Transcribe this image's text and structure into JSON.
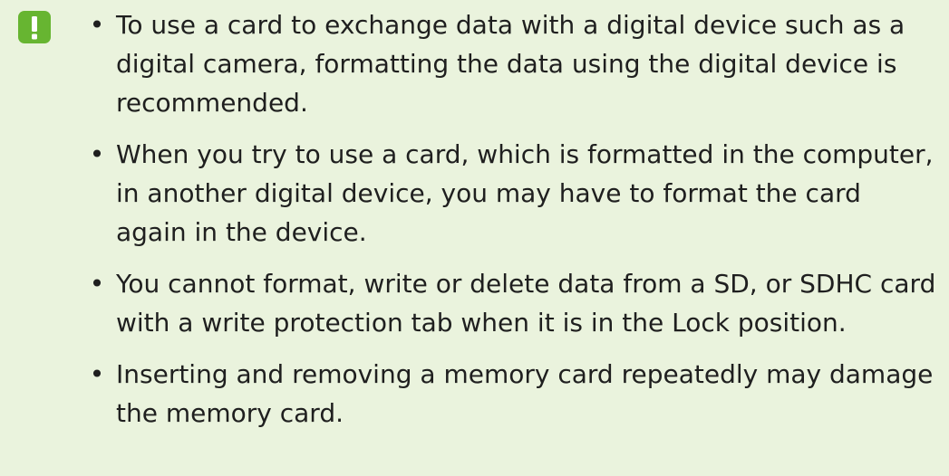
{
  "icon": {
    "name": "exclamation-icon",
    "color": "#67b531"
  },
  "items": [
    {
      "bullet": "•",
      "text": "To use a card to exchange data with a digital device such as a digital camera, formatting the data using the digital device is recommended."
    },
    {
      "bullet": "•",
      "text": "When you try to use a card, which is formatted in the computer, in another digital device, you may have to format the card again in the device."
    },
    {
      "bullet": "•",
      "text": "You cannot format, write or delete data from a SD, or SDHC card with a write protection tab when it is in the Lock position."
    },
    {
      "bullet": "•",
      "text": "Inserting and removing a memory card repeatedly may damage the memory card."
    }
  ]
}
